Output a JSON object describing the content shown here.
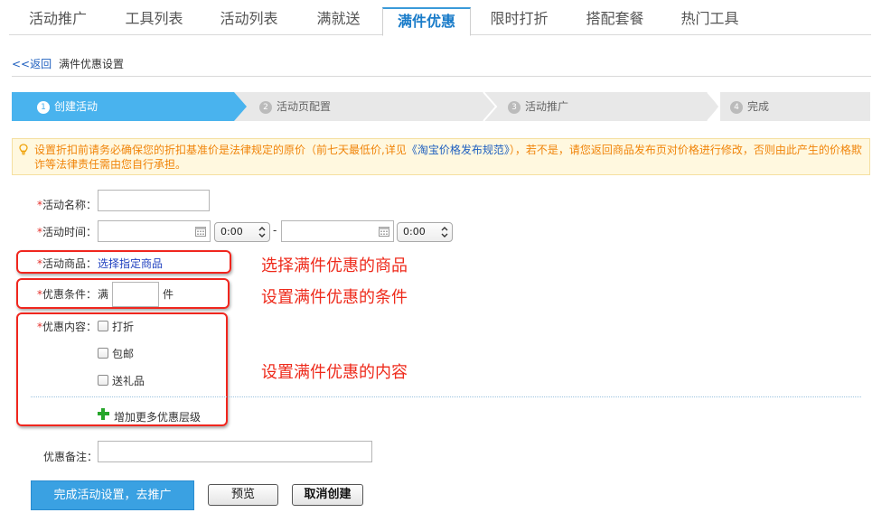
{
  "tabs": [
    {
      "label": "活动推广"
    },
    {
      "label": "工具列表"
    },
    {
      "label": "活动列表"
    },
    {
      "label": "满就送"
    },
    {
      "label": "满件优惠",
      "active": true
    },
    {
      "label": "限时打折"
    },
    {
      "label": "搭配套餐"
    },
    {
      "label": "热门工具"
    }
  ],
  "breadcrumb": {
    "back": "<<返回",
    "title": "满件优惠设置"
  },
  "steps": [
    {
      "num": "1",
      "label": "创建活动",
      "active": true
    },
    {
      "num": "2",
      "label": "活动页配置"
    },
    {
      "num": "3",
      "label": "活动推广"
    },
    {
      "num": "4",
      "label": "完成"
    }
  ],
  "colors": {
    "active_step": "#49b3ee",
    "inactive_step": "#e8e8e8",
    "tab_active": "#1a7cc9",
    "annotation": "#ee2a1b",
    "notice_text": "#f0840a"
  },
  "notice": {
    "before": "设置折扣前请务必确保您的折扣基准价是法律规定的原价（前七天最低价,详见",
    "link": "《淘宝价格发布规范》",
    "after": "），若不是，请您返回商品发布页对价格进行修改，否则由此产生的价格欺诈等法律责任需由您自行承担。"
  },
  "form": {
    "required_mark": "*",
    "name_label": "活动名称：",
    "time_label": "活动时间：",
    "time_start": "0:00",
    "time_sep": "-",
    "time_end": "0:00",
    "goods_label": "活动商品：",
    "goods_link": "选择指定商品",
    "condition_label": "优惠条件：",
    "condition_prefix": "满",
    "condition_suffix": "件",
    "content_label": "优惠内容：",
    "options": [
      "打折",
      "包邮",
      "送礼品"
    ],
    "add_level": "增加更多优惠层级",
    "remark_label": "优惠备注："
  },
  "annotations": [
    "选择满件优惠的商品",
    "设置满件优惠的条件",
    "设置满件优惠的内容"
  ],
  "buttons": {
    "submit": "完成活动设置，去推广",
    "preview": "预览",
    "cancel": "取消创建"
  }
}
